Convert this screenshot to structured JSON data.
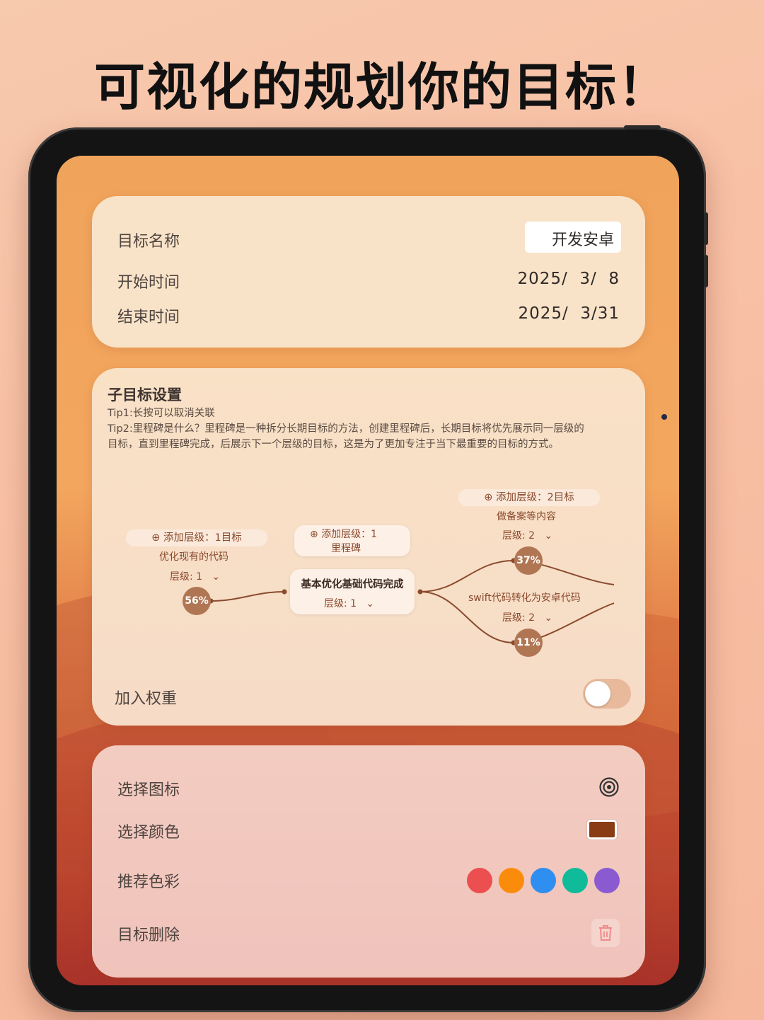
{
  "headline": "可视化的规划你的目标！",
  "goal_info": {
    "name_label": "目标名称",
    "name_value": "开发安卓",
    "start_label": "开始时间",
    "start_value": "2025/  3/  8",
    "end_label": "结束时间",
    "end_value": "2025/  3/31"
  },
  "subgoals": {
    "title": "子目标设置",
    "tip1": "Tip1:长按可以取消关联",
    "tip2": "Tip2:里程碑是什么？里程碑是一种拆分长期目标的方法，创建里程碑后，长期目标将优先展示同一层级的目标，直到里程碑完成，后展示下一个层级的目标，这是为了更加专注于当下最重要的目标的方式。",
    "left_node": {
      "add_label": "添加层级：1目标",
      "name": "优化现有的代码",
      "level": "层级: 1",
      "progress": "56%"
    },
    "center_node": {
      "add_label_line1": "添加层级：1",
      "add_label_line2": "里程碑",
      "name": "基本优化基础代码完成",
      "level": "层级: 1"
    },
    "right_top_node": {
      "add_label": "添加层级：2目标",
      "name": "做备案等内容",
      "level": "层级: 2",
      "progress": "37%"
    },
    "right_bottom_node": {
      "name": "swift代码转化为安卓代码",
      "level": "层级: 2",
      "progress": "11%"
    },
    "weight_label": "加入权重",
    "weight_enabled": false
  },
  "appearance": {
    "icon_label": "选择图标",
    "icon_name": "target-icon",
    "color_label": "选择颜色",
    "selected_color": "#8a3c14",
    "recommend_label": "推荐色彩",
    "recommended_colors": [
      "#ec4f4f",
      "#fb8c0b",
      "#2e8ff0",
      "#10bb9a",
      "#8a5bd0"
    ],
    "delete_label": "目标删除",
    "delete_icon": "trash-icon"
  }
}
